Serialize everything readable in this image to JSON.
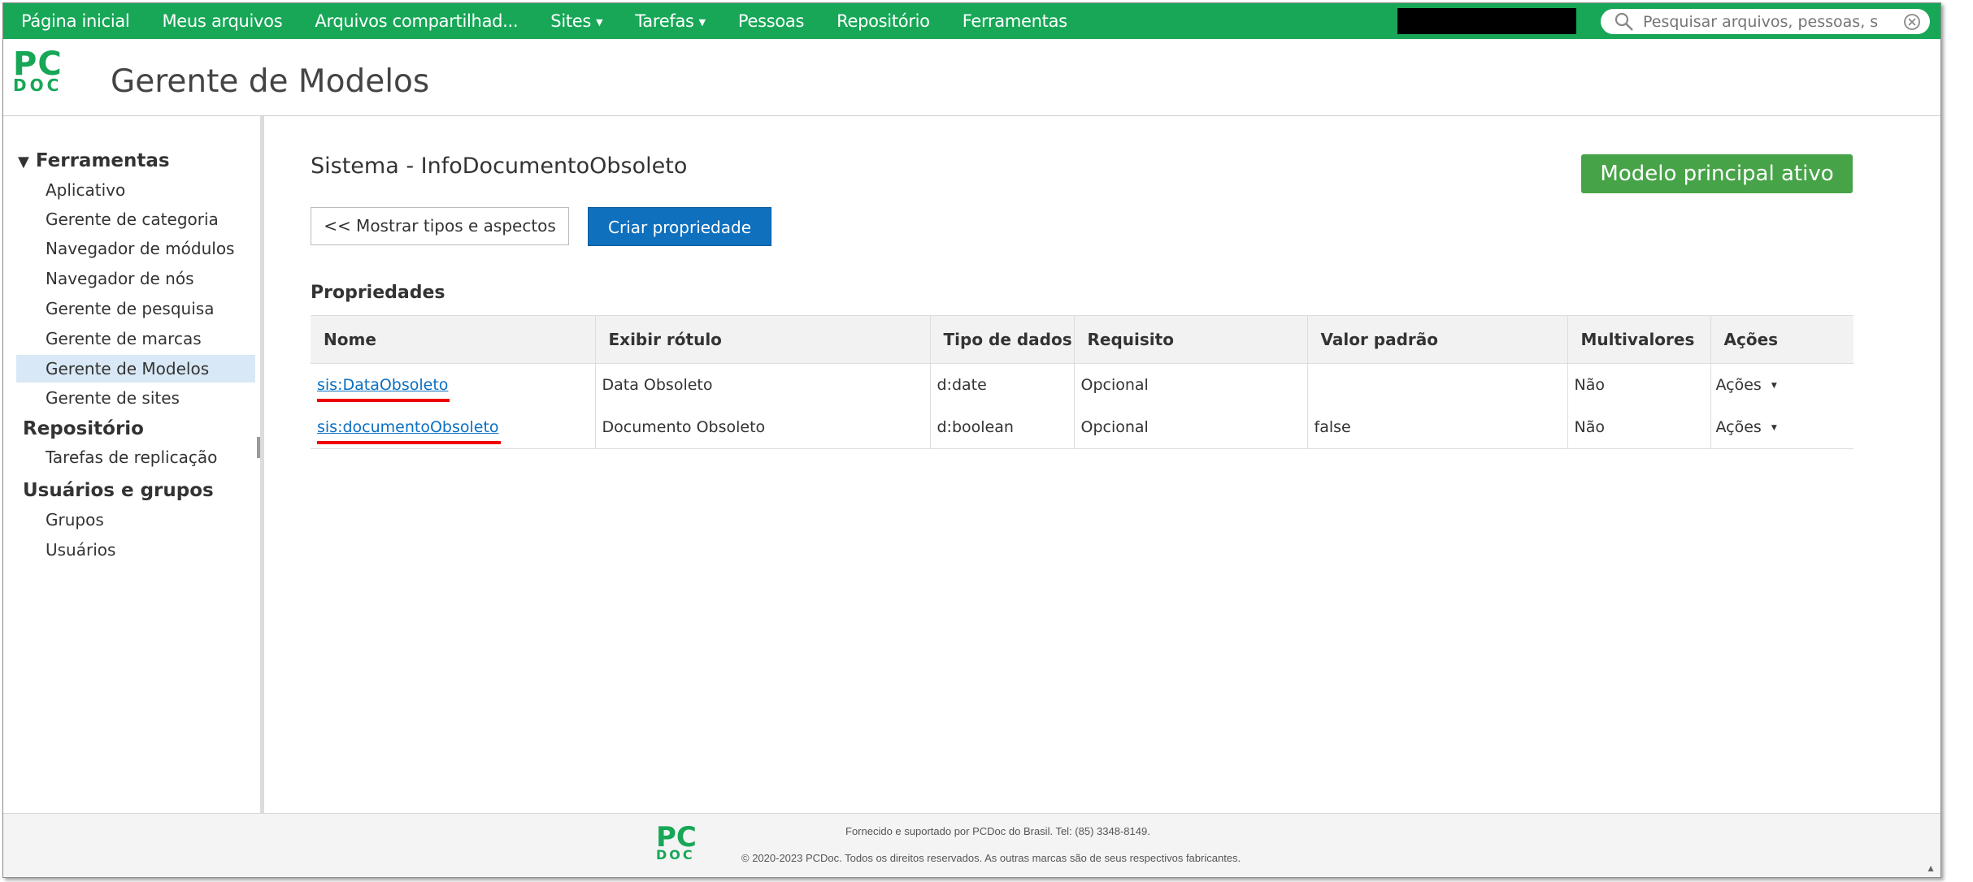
{
  "topnav": {
    "items": [
      {
        "label": "Página inicial",
        "dropdown": false
      },
      {
        "label": "Meus arquivos",
        "dropdown": false
      },
      {
        "label": "Arquivos compartilhad...",
        "dropdown": false
      },
      {
        "label": "Sites",
        "dropdown": true
      },
      {
        "label": "Tarefas",
        "dropdown": true
      },
      {
        "label": "Pessoas",
        "dropdown": false
      },
      {
        "label": "Repositório",
        "dropdown": false
      },
      {
        "label": "Ferramentas",
        "dropdown": false
      }
    ],
    "search_placeholder": "Pesquisar arquivos, pessoas, sites"
  },
  "header": {
    "logo_pc": "PC",
    "logo_doc": "DOC",
    "title": "Gerente de Modelos"
  },
  "sidebar": {
    "group1": "Ferramentas",
    "group1_items": [
      "Aplicativo",
      "Gerente de categoria",
      "Navegador de módulos",
      "Navegador de nós",
      "Gerente de pesquisa",
      "Gerente de marcas",
      "Gerente de Modelos",
      "Gerente de sites"
    ],
    "active_item": "Gerente de Modelos",
    "group2": "Repositório",
    "group2_items": [
      "Tarefas de replicação"
    ],
    "group3": "Usuários e grupos",
    "group3_items": [
      "Grupos",
      "Usuários"
    ]
  },
  "main": {
    "title": "Sistema - InfoDocumentoObsoleto",
    "active_model_button": "Modelo principal ativo",
    "show_types_button": "<< Mostrar tipos e aspectos",
    "create_property_button": "Criar propriedade",
    "section_label": "Propriedades",
    "columns": [
      "Nome",
      "Exibir rótulo",
      "Tipo de dados",
      "Requisito",
      "Valor padrão",
      "Multivalores",
      "Ações"
    ],
    "rows": [
      {
        "name": "sis:DataObsoleto",
        "label": "Data Obsoleto",
        "type": "d:date",
        "requirement": "Opcional",
        "default": "",
        "multivalue": "Não",
        "actions": "Ações"
      },
      {
        "name": "sis:documentoObsoleto",
        "label": "Documento Obsoleto",
        "type": "d:boolean",
        "requirement": "Opcional",
        "default": "false",
        "multivalue": "Não",
        "actions": "Ações"
      }
    ]
  },
  "footer": {
    "line1": "Fornecido e suportado por PCDoc do Brasil. Tel: (85) 3348-8149.",
    "line2": "© 2020-2023 PCDoc. Todos os direitos reservados. As outras marcas são de seus respectivos fabricantes.",
    "logo_pc": "PC",
    "logo_doc": "DOC"
  },
  "colors": {
    "nav_green": "#17a757",
    "primary_blue": "#0f70be",
    "active_green": "#47a348",
    "link": "#0b6fc2",
    "highlight_underline": "#e00000",
    "sidebar_active": "#d9e8f6"
  }
}
